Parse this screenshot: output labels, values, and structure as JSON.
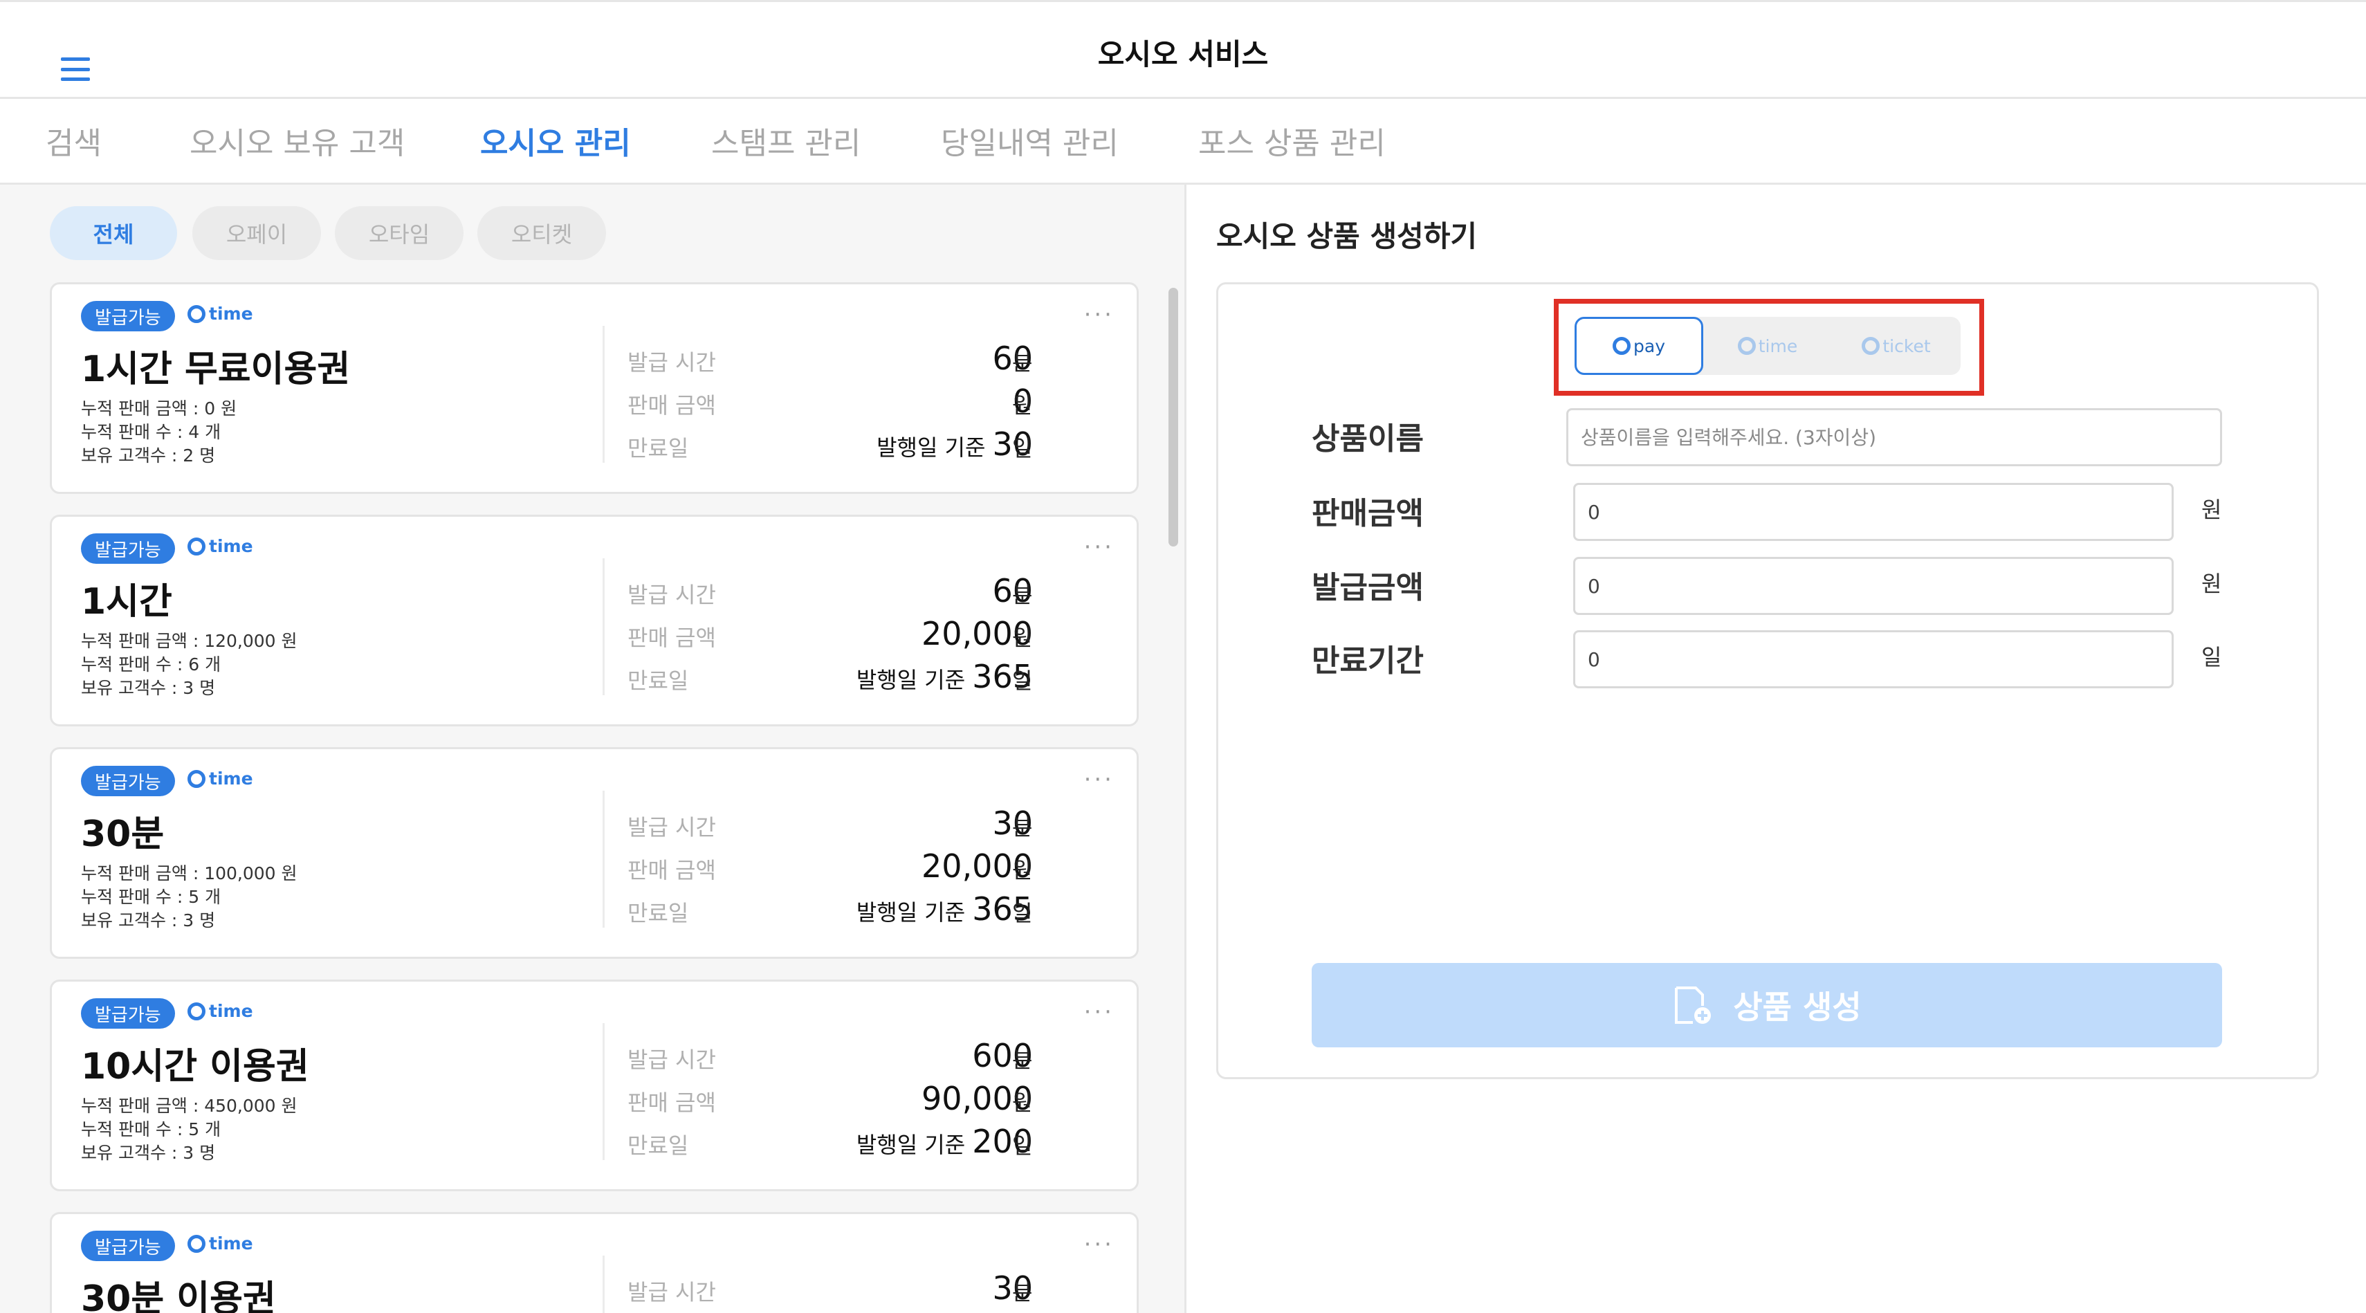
{
  "header": {
    "title": "오시오 서비스",
    "menu_icon": "hamburger-menu-icon"
  },
  "tabs": [
    {
      "label": "검색"
    },
    {
      "label": "오시오 보유 고객"
    },
    {
      "label": "오시오 관리"
    },
    {
      "label": "스탬프 관리"
    },
    {
      "label": "당일내역 관리"
    },
    {
      "label": "포스 상품 관리"
    }
  ],
  "active_tab": "오시오 관리",
  "filters": [
    "전체",
    "오페이",
    "오타임",
    "오티켓"
  ],
  "active_filter": "전체",
  "labels": {
    "issue_time": "발급 시간",
    "sale_amount": "판매 금액",
    "expiry": "만료일",
    "expiry_prefix": "발행일 기준"
  },
  "products": [
    {
      "badge": "발급가능",
      "type": "time",
      "name": "1시간 무료이용권",
      "stat_sales": "누적 판매 금액 : 0 원",
      "stat_count": "누적 판매 수 : 4 개",
      "stat_holders": "보유 고객수 : 2 명",
      "issue_time": "60",
      "issue_unit": "분",
      "price": "0",
      "price_unit": "원",
      "expiry": "30",
      "expiry_unit": "일"
    },
    {
      "badge": "발급가능",
      "type": "time",
      "name": "1시간",
      "stat_sales": "누적 판매 금액 : 120,000 원",
      "stat_count": "누적 판매 수 : 6 개",
      "stat_holders": "보유 고객수 : 3 명",
      "issue_time": "60",
      "issue_unit": "분",
      "price": "20,000",
      "price_unit": "원",
      "expiry": "365",
      "expiry_unit": "일"
    },
    {
      "badge": "발급가능",
      "type": "time",
      "name": "30분",
      "stat_sales": "누적 판매 금액 : 100,000 원",
      "stat_count": "누적 판매 수 : 5 개",
      "stat_holders": "보유 고객수 : 3 명",
      "issue_time": "30",
      "issue_unit": "분",
      "price": "20,000",
      "price_unit": "원",
      "expiry": "365",
      "expiry_unit": "일"
    },
    {
      "badge": "발급가능",
      "type": "time",
      "name": "10시간 이용권",
      "stat_sales": "누적 판매 금액 : 450,000 원",
      "stat_count": "누적 판매 수 : 5 개",
      "stat_holders": "보유 고객수 : 3 명",
      "issue_time": "600",
      "issue_unit": "분",
      "price": "90,000",
      "price_unit": "원",
      "expiry": "200",
      "expiry_unit": "일"
    },
    {
      "badge": "발급가능",
      "type": "time",
      "name": "30분 이용권",
      "issue_time": "30",
      "issue_unit": "분"
    }
  ],
  "form": {
    "title": "오시오 상품 생성하기",
    "types": [
      "pay",
      "time",
      "ticket"
    ],
    "active_type": "pay",
    "name_label": "상품이름",
    "name_placeholder": "상품이름을 입력해주세요. (3자이상)",
    "price_label": "판매금액",
    "price_value": "0",
    "price_unit": "원",
    "issue_label": "발급금액",
    "issue_value": "0",
    "issue_unit": "원",
    "expiry_label": "만료기간",
    "expiry_value": "0",
    "expiry_unit": "일",
    "submit_label": "상품 생성",
    "submit_icon": "add-document-icon"
  },
  "colors": {
    "accent": "#2f7de1",
    "highlight": "#e03026",
    "submit_disabled": "#bfdbfb"
  }
}
